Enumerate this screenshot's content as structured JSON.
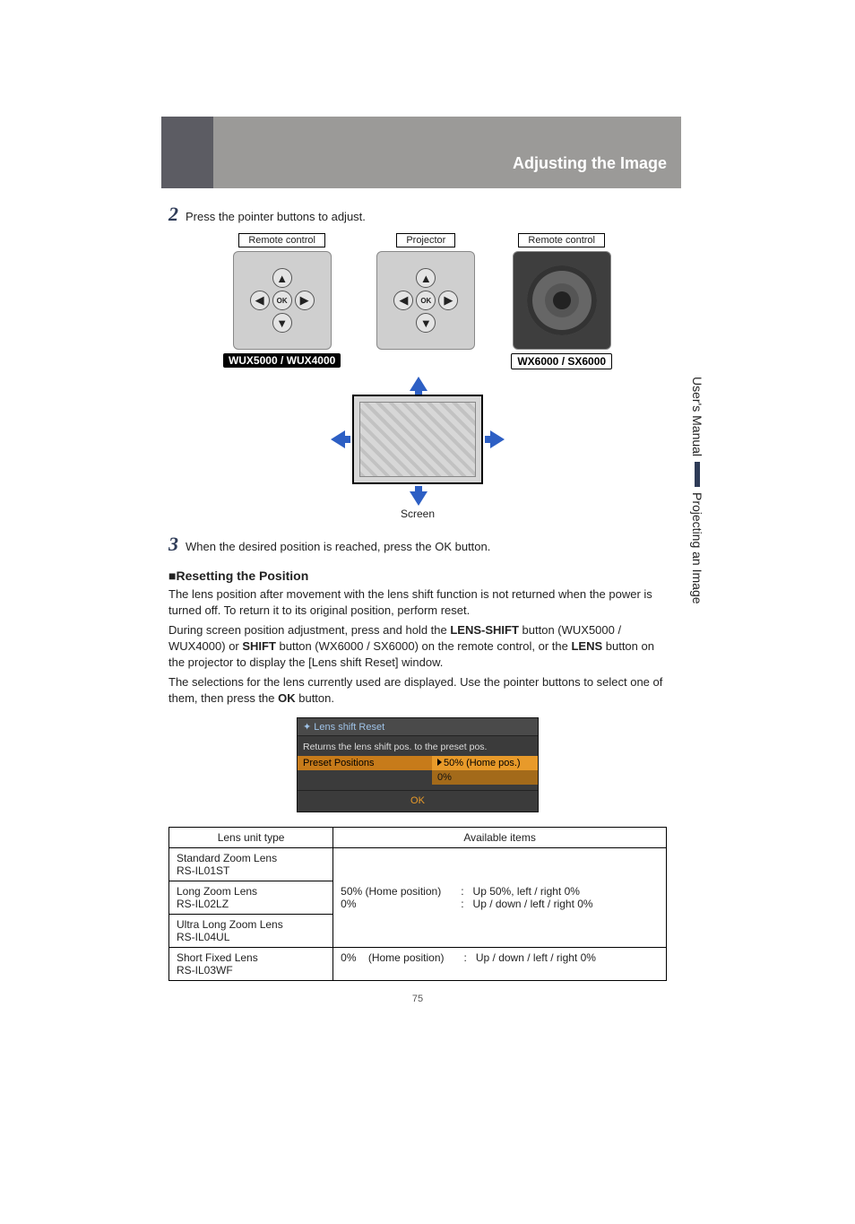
{
  "header": {
    "title": "Adjusting the Image"
  },
  "sidebar": {
    "tab_a": "User's Manual",
    "tab_b": "Projecting an Image"
  },
  "steps": {
    "s2": {
      "num": "2",
      "text": "Press the pointer buttons to adjust."
    },
    "s3": {
      "num": "3",
      "text": "When the desired position is reached, press the OK button."
    }
  },
  "controls": {
    "remote_label": "Remote control",
    "projector_label": "Projector",
    "ok": "OK",
    "model_a": "WUX5000 / WUX4000",
    "model_b": "WX6000 / SX6000"
  },
  "screen_caption": "Screen",
  "reset": {
    "heading_prefix": "■",
    "heading": "Resetting the Position",
    "p1": "The lens position after movement with the lens shift function is not returned when the power is turned off. To return it to its original position, perform reset.",
    "p2a": "During screen position adjustment, press and hold the ",
    "b1": "LENS-SHIFT",
    "p2b": " button (WUX5000 / WUX4000) or ",
    "b2": "SHIFT",
    "p2c": " button (WX6000 / SX6000) on the remote control, or the ",
    "b3": "LENS",
    "p2d": " button on the projector to display the [Lens shift Reset] window.",
    "p3a": "The selections for the lens currently used are displayed. Use the pointer buttons to select one of them, then press the ",
    "b4": "OK",
    "p3b": " button."
  },
  "osd": {
    "title": "Lens shift Reset",
    "subtitle": "Returns the lens shift pos. to the preset pos.",
    "row_label": "Preset Positions",
    "opt1": "50% (Home pos.)",
    "opt2": "0%",
    "ok": "OK"
  },
  "table": {
    "h1": "Lens unit type",
    "h2": "Available items",
    "rows": [
      {
        "type": "Standard Zoom Lens\nRS-IL01ST"
      },
      {
        "type": "Long Zoom Lens\nRS-IL02LZ"
      },
      {
        "type": "Ultra Long Zoom Lens\nRS-IL04UL"
      },
      {
        "type": "Short Fixed Lens\nRS-IL03WF"
      }
    ],
    "group1": {
      "left": "50% (Home position)\n0%",
      "right": ":   Up 50%, left / right 0%\n:   Up / down / left / right 0%"
    },
    "group2": {
      "left": "0%    (Home position)",
      "right": ":   Up / down / left / right 0%"
    }
  },
  "page_number": "75"
}
